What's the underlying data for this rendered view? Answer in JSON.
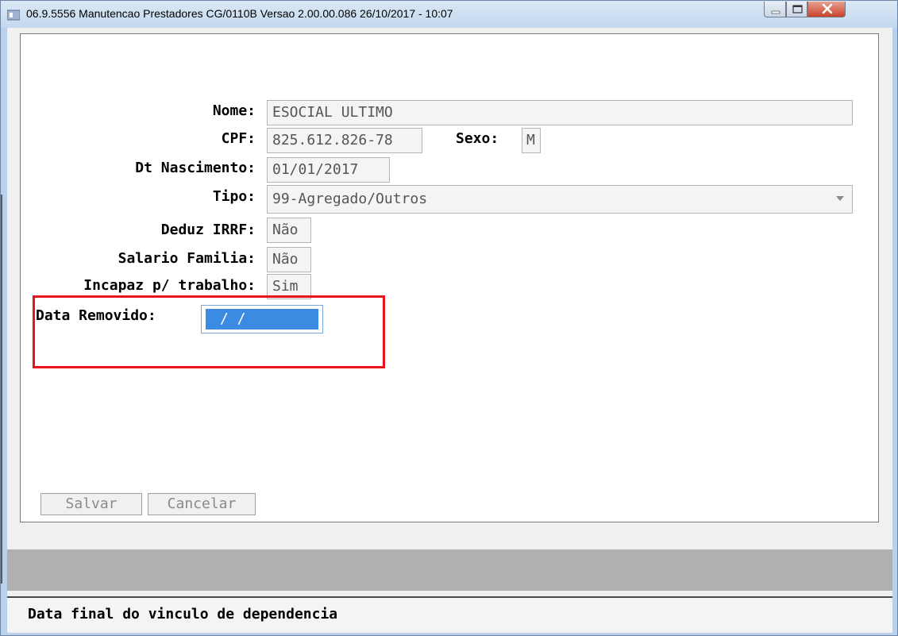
{
  "window": {
    "title": "06.9.5556 Manutencao  Prestadores CG/0110B Versao 2.00.00.086 26/10/2017 - 10:07"
  },
  "form": {
    "nome": {
      "label": "Nome:",
      "value": "ESOCIAL ULTIMO"
    },
    "cpf": {
      "label": "CPF:",
      "value": "825.612.826-78"
    },
    "sexo": {
      "label": "Sexo:",
      "value": "M"
    },
    "dt_nascimento": {
      "label": "Dt Nascimento:",
      "value": "01/01/2017"
    },
    "tipo": {
      "label": "Tipo:",
      "value": "99-Agregado/Outros"
    },
    "deduz_irrf": {
      "label": "Deduz IRRF:",
      "value": "Não"
    },
    "salario_familia": {
      "label": "Salario Familia:",
      "value": "Não"
    },
    "incapaz": {
      "label": "Incapaz p/ trabalho:",
      "value": "Sim"
    },
    "data_removido": {
      "label": "Data Removido:",
      "value": "  /  /"
    }
  },
  "buttons": {
    "salvar": "Salvar",
    "cancelar": "Cancelar"
  },
  "status": {
    "text": "Data final do vinculo de dependencia"
  },
  "colors": {
    "highlight_border": "#e8141c",
    "selection": "#3c8be2",
    "title_bar": "#c3d8ee"
  }
}
